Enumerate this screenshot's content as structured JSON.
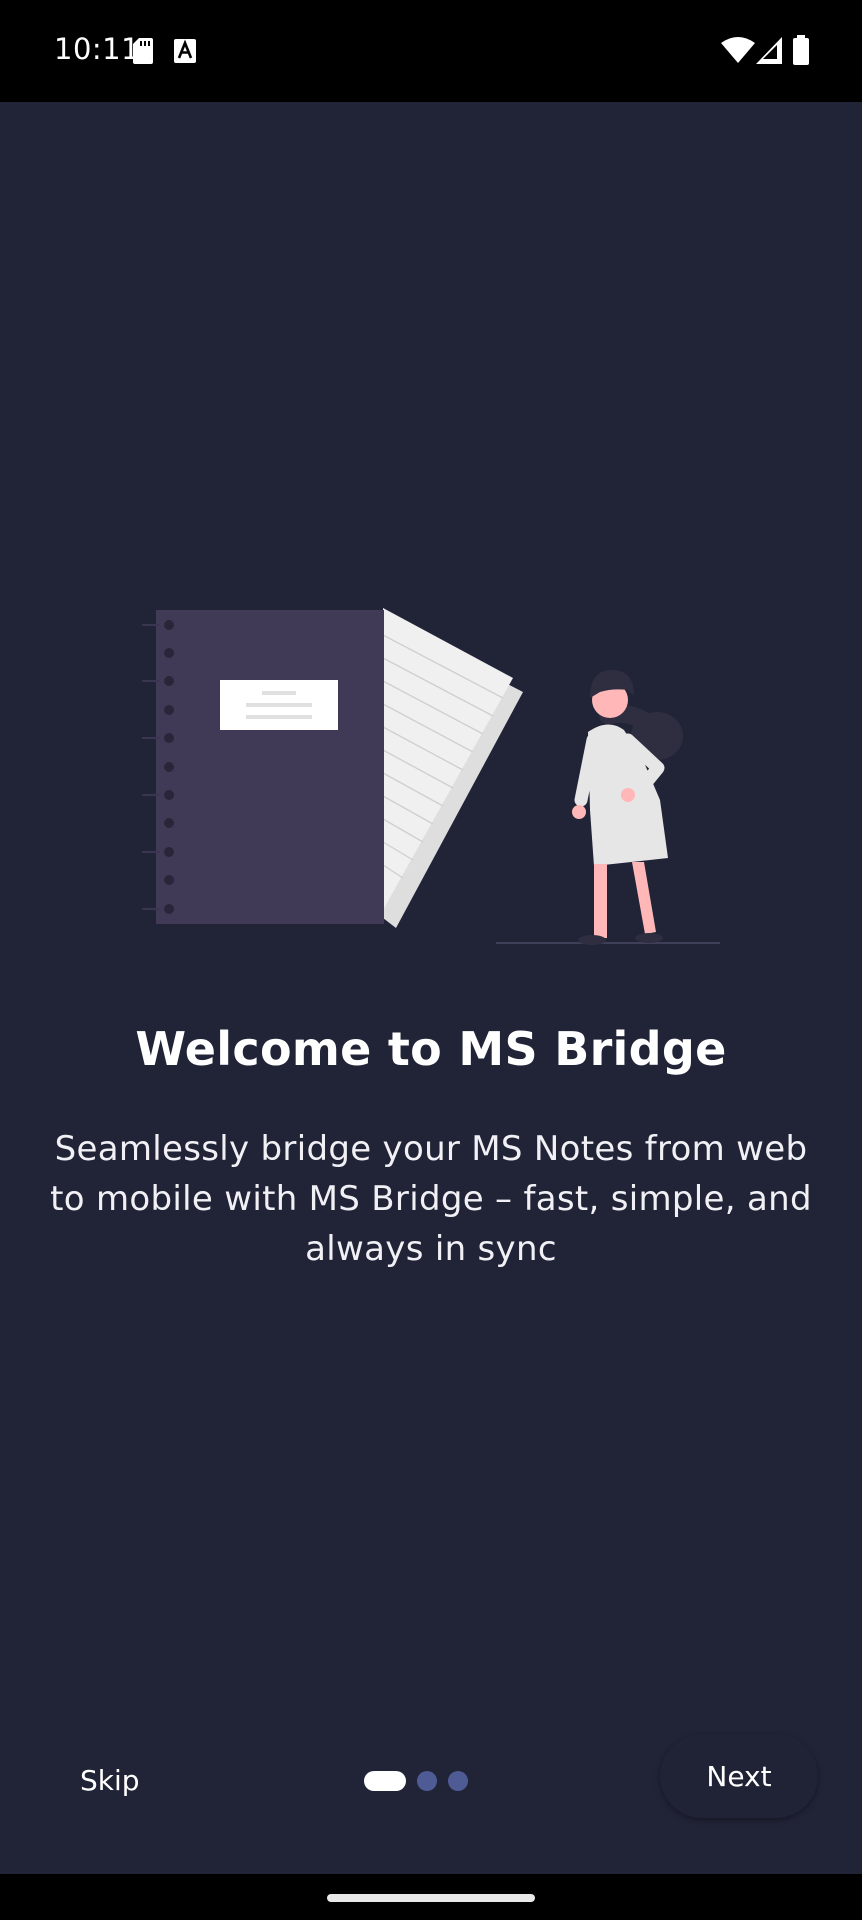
{
  "status_bar": {
    "time": "10:11",
    "icons": [
      "sd-card-icon",
      "keyboard-a-icon",
      "wifi-icon",
      "signal-icon",
      "battery-icon"
    ]
  },
  "onboarding": {
    "title": "Welcome to MS Bridge",
    "subtitle": "Seamlessly bridge your MS Notes from web to mobile with MS Bridge – fast, simple, and always in sync",
    "skip_label": "Skip",
    "next_label": "Next",
    "page_indicator": {
      "current": 1,
      "total": 3
    }
  },
  "colors": {
    "background": "#212337",
    "dot_active": "#ffffff",
    "dot_inactive": "#4f5b95",
    "notebook": "#403a57",
    "paper": "#f0f0f0",
    "skin": "#ffb7b7"
  }
}
